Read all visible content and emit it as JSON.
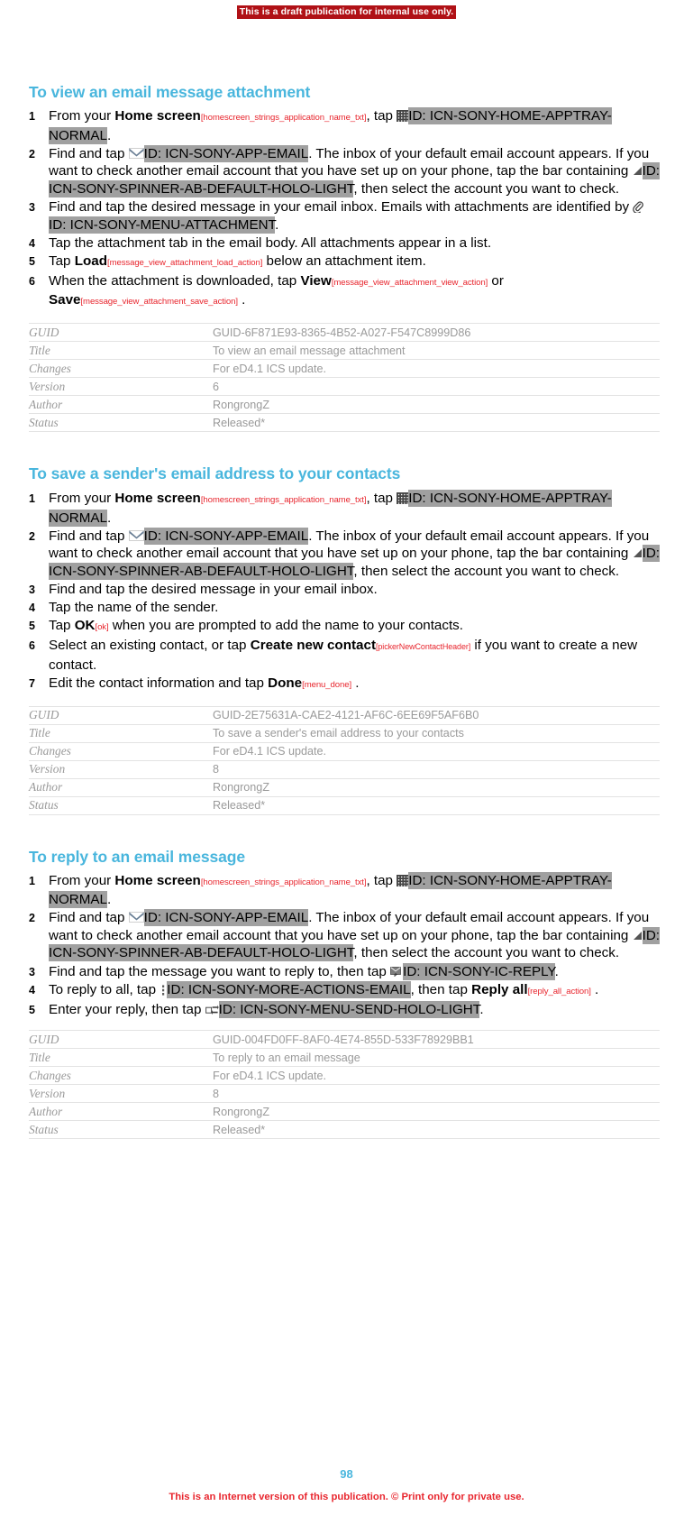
{
  "draft_banner": "This is a draft publication for internal use only.",
  "page_number": "98",
  "footer_note": "This is an Internet version of this publication. © Print only for private use.",
  "colors": {
    "heading": "#49b6dd",
    "annotation_red": "#e8262e",
    "banner_red": "#b01116",
    "idref_highlight": "#a0a0a0",
    "table_text": "#9a9a9a"
  },
  "sections": [
    {
      "title": "To view an email message attachment",
      "steps": {
        "s1": {
          "t1": "From your ",
          "b1": "Home screen",
          "rid1": "[homescreen_strings_application_name_txt]",
          "t2": ", tap ",
          "icon1": "apptray-icon",
          "id1": "ID: ICN-SONY-HOME-APPTRAY-NORMAL",
          "t3": "."
        },
        "s2": {
          "t1": "Find and tap ",
          "icon1": "email-icon",
          "id1": "ID: ICN-SONY-APP-EMAIL",
          "t2": ". The inbox of your default email account appears. If you want to check another email account that you have set up on your phone, tap the bar containing ",
          "icon2": "spinner-icon",
          "id2": "ID: ICN-SONY-SPINNER-AB-DEFAULT-HOLO-LIGHT",
          "t3": ", then select the account you want to check."
        },
        "s3": {
          "t1": "Find and tap the desired message in your email inbox. Emails with attachments are identified by ",
          "icon1": "attachment-icon",
          "id1": "ID: ICN-SONY-MENU-ATTACHMENT",
          "t2": "."
        },
        "s4": {
          "t1": "Tap the attachment tab in the email body. All attachments appear in a list."
        },
        "s5": {
          "t1": "Tap ",
          "b1": "Load",
          "rid1": "[message_view_attachment_load_action]",
          "t2": " below an attachment item."
        },
        "s6": {
          "t1": "When the attachment is downloaded, tap ",
          "b1": "View",
          "rid1": "[message_view_attachment_view_action]",
          "t2": " or ",
          "b2": "Save",
          "rid2": "[message_view_attachment_save_action]",
          "t3": " ."
        }
      },
      "meta": [
        {
          "key": "GUID",
          "value": "GUID-6F871E93-8365-4B52-A027-F547C8999D86"
        },
        {
          "key": "Title",
          "value": "To view an email message attachment"
        },
        {
          "key": "Changes",
          "value": "For eD4.1 ICS update."
        },
        {
          "key": "Version",
          "value": "6"
        },
        {
          "key": "Author",
          "value": "RongrongZ"
        },
        {
          "key": "Status",
          "value": "Released*"
        }
      ]
    },
    {
      "title": "To save a sender's email address to your contacts",
      "steps": {
        "s1": {
          "t1": "From your ",
          "b1": "Home screen",
          "rid1": "[homescreen_strings_application_name_txt]",
          "t2": ", tap ",
          "icon1": "apptray-icon",
          "id1": "ID: ICN-SONY-HOME-APPTRAY-NORMAL",
          "t3": "."
        },
        "s2": {
          "t1": "Find and tap ",
          "icon1": "email-icon",
          "id1": "ID: ICN-SONY-APP-EMAIL",
          "t2": ". The inbox of your default email account appears. If you want to check another email account that you have set up on your phone, tap the bar containing ",
          "icon2": "spinner-icon",
          "id2": "ID: ICN-SONY-SPINNER-AB-DEFAULT-HOLO-LIGHT",
          "t3": ", then select the account you want to check."
        },
        "s3": {
          "t1": "Find and tap the desired message in your email inbox."
        },
        "s4": {
          "t1": "Tap the name of the sender."
        },
        "s5": {
          "t1": "Tap ",
          "b1": "OK",
          "rid1": "[ok]",
          "t2": " when you are prompted to add the name to your contacts."
        },
        "s6": {
          "t1": "Select an existing contact, or tap ",
          "b1": "Create new contact",
          "rid1": "[pickerNewContactHeader]",
          "t2": " if you want to create a new contact."
        },
        "s7": {
          "t1": "Edit the contact information and tap ",
          "b1": "Done",
          "rid1": "[menu_done]",
          "t2": " ."
        }
      },
      "meta": [
        {
          "key": "GUID",
          "value": "GUID-2E75631A-CAE2-4121-AF6C-6EE69F5AF6B0"
        },
        {
          "key": "Title",
          "value": "To save a sender's email address to your contacts"
        },
        {
          "key": "Changes",
          "value": "For eD4.1 ICS update."
        },
        {
          "key": "Version",
          "value": "8"
        },
        {
          "key": "Author",
          "value": "RongrongZ"
        },
        {
          "key": "Status",
          "value": "Released*"
        }
      ]
    },
    {
      "title": "To reply to an email message",
      "steps": {
        "s1": {
          "t1": "From your ",
          "b1": "Home screen",
          "rid1": "[homescreen_strings_application_name_txt]",
          "t2": ", tap ",
          "icon1": "apptray-icon",
          "id1": "ID: ICN-SONY-HOME-APPTRAY-NORMAL",
          "t3": "."
        },
        "s2": {
          "t1": "Find and tap ",
          "icon1": "email-icon",
          "id1": "ID: ICN-SONY-APP-EMAIL",
          "t2": ". The inbox of your default email account appears. If you want to check another email account that you have set up on your phone, tap the bar containing ",
          "icon2": "spinner-icon",
          "id2": "ID: ICN-SONY-SPINNER-AB-DEFAULT-HOLO-LIGHT",
          "t3": ", then select the account you want to check."
        },
        "s3": {
          "t1": "Find and tap the message you want to reply to, then tap ",
          "icon1": "reply-icon",
          "id1": "ID: ICN-SONY-IC-REPLY",
          "t2": "."
        },
        "s4": {
          "t1": "To reply to all, tap ",
          "icon1": "more-actions-icon",
          "id1": "ID: ICN-SONY-MORE-ACTIONS-EMAIL",
          "t2": ", then tap ",
          "b1": "Reply all",
          "rid1": "[reply_all_action]",
          "t3": " ."
        },
        "s5": {
          "t1": "Enter your reply, then tap ",
          "icon1": "send-icon",
          "id1": "ID: ICN-SONY-MENU-SEND-HOLO-LIGHT",
          "t2": "."
        }
      },
      "meta": [
        {
          "key": "GUID",
          "value": "GUID-004FD0FF-8AF0-4E74-855D-533F78929BB1"
        },
        {
          "key": "Title",
          "value": "To reply to an email message"
        },
        {
          "key": "Changes",
          "value": "For eD4.1 ICS update."
        },
        {
          "key": "Version",
          "value": "8"
        },
        {
          "key": "Author",
          "value": "RongrongZ"
        },
        {
          "key": "Status",
          "value": "Released*"
        }
      ]
    }
  ]
}
